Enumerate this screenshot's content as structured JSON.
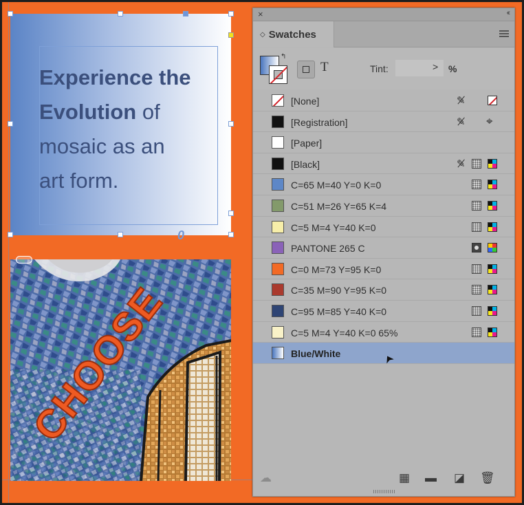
{
  "document": {
    "frame_text": {
      "bold_line1": "Experience the",
      "bold_line2a": "Evolution",
      "line2b": " of",
      "line3": "mosaic as an",
      "line4": "art form."
    },
    "thread_glyph": "0",
    "mosaic_word": "CHOOSE"
  },
  "panel": {
    "close_label": "×",
    "collapse_label": "‹‹",
    "tab_label": "Swatches",
    "tab_arrows": "◇",
    "text_button_label": "T",
    "tint_label": "Tint:",
    "tint_value": "",
    "tint_arrow": ">",
    "tint_unit": "%",
    "swatches": [
      {
        "name": "[None]",
        "chip": "none",
        "lock": true,
        "type": "none"
      },
      {
        "name": "[Registration]",
        "chip": "#111111",
        "lock": true,
        "type": "registration"
      },
      {
        "name": "[Paper]",
        "chip": "#ffffff",
        "lock": false,
        "type": ""
      },
      {
        "name": "[Black]",
        "chip": "#111111",
        "lock": true,
        "type": "process-cmyk"
      },
      {
        "name": "C=65 M=40 Y=0 K=0",
        "chip": "#5d87c7",
        "lock": false,
        "type": "process-cmyk"
      },
      {
        "name": "C=51 M=26 Y=65 K=4",
        "chip": "#839a6b",
        "lock": false,
        "type": "process-cmyk"
      },
      {
        "name": "C=5 M=4 Y=40 K=0",
        "chip": "#f7eea9",
        "lock": false,
        "type": "process-cmyk"
      },
      {
        "name": "PANTONE 265 C",
        "chip": "#8a62b8",
        "lock": false,
        "type": "spot-lab"
      },
      {
        "name": "C=0 M=73 Y=95 K=0",
        "chip": "#f26a25",
        "lock": false,
        "type": "process-cmyk"
      },
      {
        "name": "C=35 M=90 Y=95 K=0",
        "chip": "#aa3a2e",
        "lock": false,
        "type": "process-cmyk"
      },
      {
        "name": "C=95 M=85 Y=40 K=0",
        "chip": "#2e4474",
        "lock": false,
        "type": "process-cmyk"
      },
      {
        "name": "C=5 M=4 Y=40 K=0 65%",
        "chip": "#f9f2c8",
        "lock": false,
        "type": "process-cmyk"
      },
      {
        "name": "Blue/White",
        "chip": "gradient",
        "lock": false,
        "type": "",
        "selected": true
      }
    ]
  },
  "colors": {
    "canvas": "#f26a25",
    "panel": "#b7b7b7",
    "selection": "#8ea5cc",
    "text_dark_blue": "#3b4f7c"
  }
}
